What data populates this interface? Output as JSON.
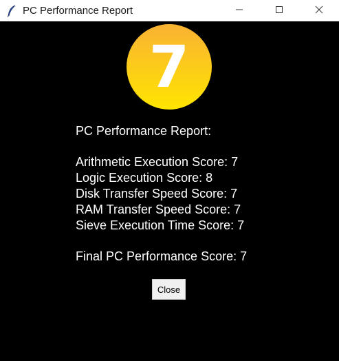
{
  "window": {
    "title": "PC Performance Report",
    "icon": "feather-icon",
    "controls": [
      "minimize-icon",
      "maximize-icon",
      "close-icon"
    ]
  },
  "badge": {
    "score": "7",
    "colors": {
      "top": "#f9b233",
      "bottom": "#ffe500",
      "text": "#ffffff"
    }
  },
  "report": {
    "heading": "PC Performance Report:",
    "lines": [
      "Arithmetic Execution Score: 7",
      "Logic Execution Score: 8",
      "Disk Transfer Speed Score: 7",
      "RAM Transfer Speed Score: 7",
      "Sieve Execution Time Score: 7"
    ],
    "final": "Final PC Performance Score: 7"
  },
  "close_button": {
    "label": "Close"
  }
}
